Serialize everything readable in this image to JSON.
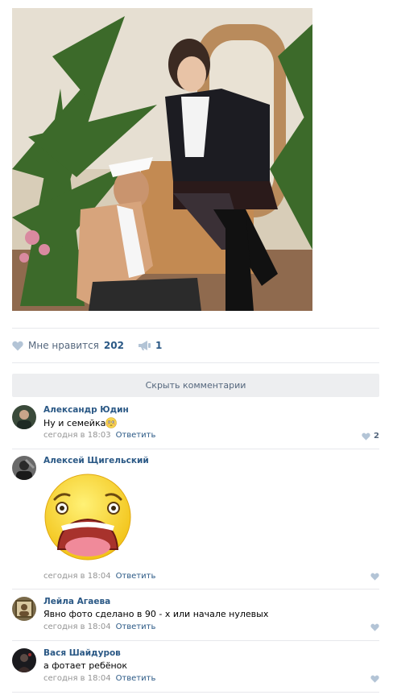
{
  "post": {
    "likes_label": "Мне нравится",
    "likes_count": "202",
    "shares_count": "1",
    "hide_comments_label": "Скрыть комментарии"
  },
  "comments": [
    {
      "author": "Александр Юдин",
      "text": "Ну и семейка",
      "time": "сегодня в 18:03",
      "reply": "Ответить",
      "likes": "2",
      "emoji": "flushed-face"
    },
    {
      "author": "Алексей Щигельский",
      "time": "сегодня в 18:04",
      "reply": "Ответить",
      "sticker": "shocked-face-sticker"
    },
    {
      "author": "Лейла Агаева",
      "text": "Явно фото сделано в 90 - х или начале нулевых",
      "time": "сегодня в 18:04",
      "reply": "Ответить"
    },
    {
      "author": "Вася Шайдуров",
      "text": "а фотает ребёнок",
      "time": "сегодня в 18:04",
      "reply": "Ответить"
    }
  ],
  "colors": {
    "link": "#2a5885",
    "muted": "#939393",
    "divider": "#e7e8ec",
    "button_bg": "#edeef0",
    "icon": "#b3c4d6"
  }
}
